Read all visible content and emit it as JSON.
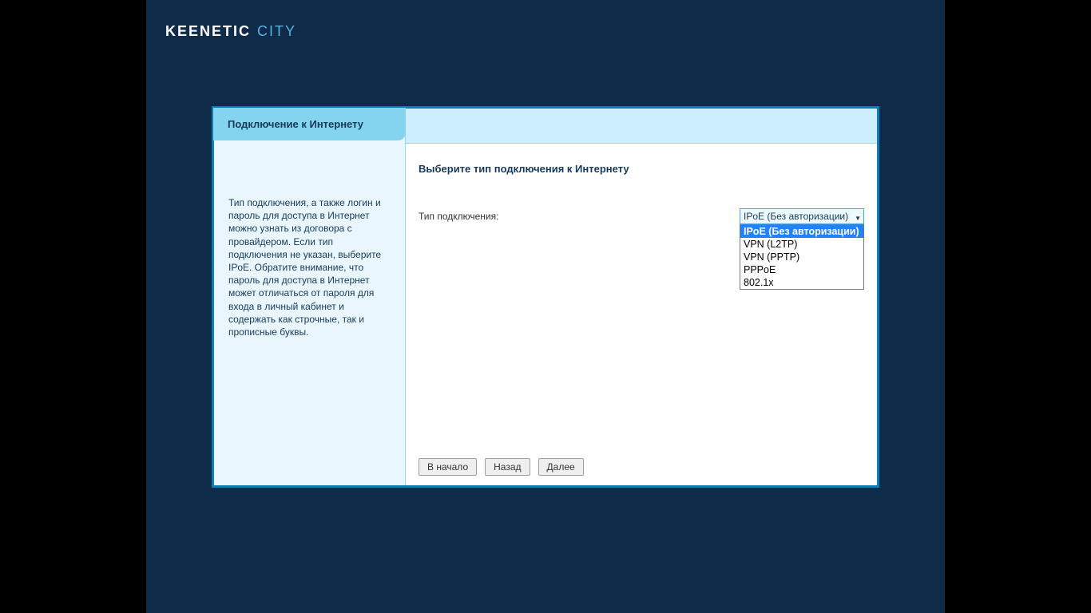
{
  "brand": {
    "keenetic": "KEENETIC",
    "city": "CITY"
  },
  "sidebar": {
    "tab_label": "Подключение к Интернету",
    "help_text": "Тип подключения, а также логин и пароль для доступа в Интернет можно узнать из договора с провайдером. Если тип подключения не указан, выберите IPoE. Обратите внимание, что пароль для доступа в Интернет может отличаться от пароля для входа в личный кабинет и содержать как строчные, так и прописные буквы."
  },
  "main": {
    "title": "Выберите тип подключения к Интернету",
    "field_label": "Тип подключения:",
    "select": {
      "value": "IPoE (Без авторизации)",
      "options": [
        "IPoE (Без авторизации)",
        "VPN (L2TP)",
        "VPN (PPTP)",
        "PPPoE",
        "802.1x"
      ],
      "selected_index": 0
    },
    "buttons": {
      "home": "В начало",
      "back": "Назад",
      "next": "Далее"
    }
  }
}
